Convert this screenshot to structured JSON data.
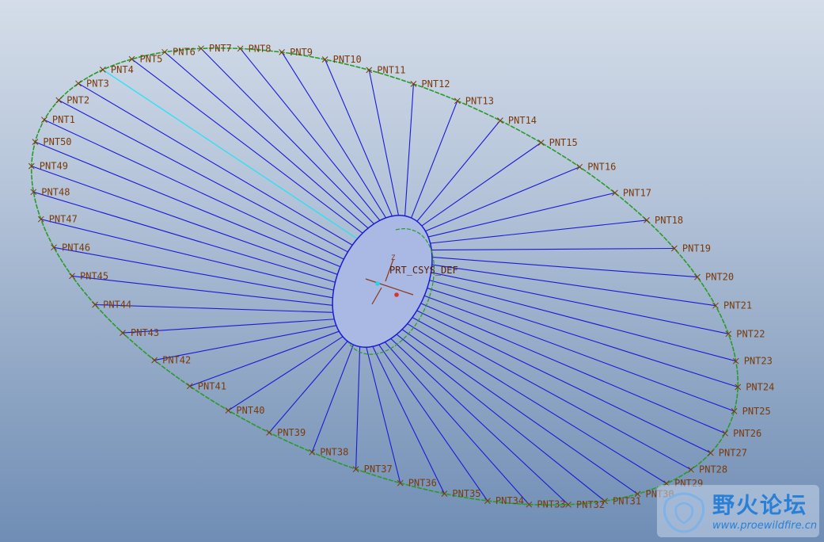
{
  "scene": {
    "colors": {
      "background_top": "#d4dde9",
      "background_bottom": "#6f8db5",
      "spoke": "#1a1ad6",
      "highlighted_spoke": "#30e0f0",
      "ellipse": "#2a9a2a",
      "point_marker": "#7a3a0a",
      "label": "#7a3a0a",
      "hub_fill": "#a9b9e4"
    },
    "highlighted_point": "PNT4",
    "coordinate_system_label": "PRT_CSYS_DEF",
    "points": [
      "PNT1",
      "PNT2",
      "PNT3",
      "PNT4",
      "PNT5",
      "PNT6",
      "PNT7",
      "PNT8",
      "PNT9",
      "PNT10",
      "PNT11",
      "PNT12",
      "PNT13",
      "PNT14",
      "PNT15",
      "PNT16",
      "PNT17",
      "PNT18",
      "PNT19",
      "PNT20",
      "PNT21",
      "PNT22",
      "PNT23",
      "PNT24",
      "PNT25",
      "PNT26",
      "PNT27",
      "PNT28",
      "PNT29",
      "PNT30",
      "PNT31",
      "PNT32",
      "PNT33",
      "PNT34",
      "PNT35",
      "PNT36",
      "PNT37",
      "PNT38",
      "PNT39",
      "PNT40",
      "PNT41",
      "PNT42",
      "PNT43",
      "PNT44",
      "PNT45",
      "PNT46",
      "PNT47",
      "PNT48",
      "PNT49",
      "PNT50"
    ]
  },
  "watermark": {
    "title": "野火论坛",
    "url": "www.proewildfire.cn"
  }
}
